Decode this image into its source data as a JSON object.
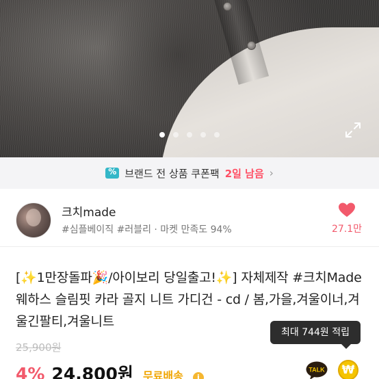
{
  "gallery": {
    "dot_count": 5,
    "active_index": 0
  },
  "coupon": {
    "text": "브랜드 전 상품 쿠폰팩",
    "days": "2일 남음",
    "arrow": "›"
  },
  "shop": {
    "name": "크치made",
    "tags": "#심플베이직 #러블리 · 마켓 만족도 94%",
    "like_count": "27.1만"
  },
  "product": {
    "title": "[✨1만장돌파🎉/아이보리 당일출고!✨] 자체제작 #크치Made 웨하스 슬림핏 카라 골지 니트 가디건 - cd / 봄,가을,겨울이너,겨울긴팔티,겨울니트",
    "original_price": "25,900원",
    "discount": "4%",
    "price": "24,800원",
    "shipping": "무료배송",
    "shipping_info": "i"
  },
  "tooltip": {
    "text": "최대 744원 적립"
  },
  "actions": {
    "talk_label": "TALK",
    "won_symbol": "₩"
  },
  "colors": {
    "accent_pink": "#f2596b",
    "coupon_teal": "#34b7c8",
    "shipping_orange": "#f0a500",
    "won_yellow": "#f5c400"
  }
}
